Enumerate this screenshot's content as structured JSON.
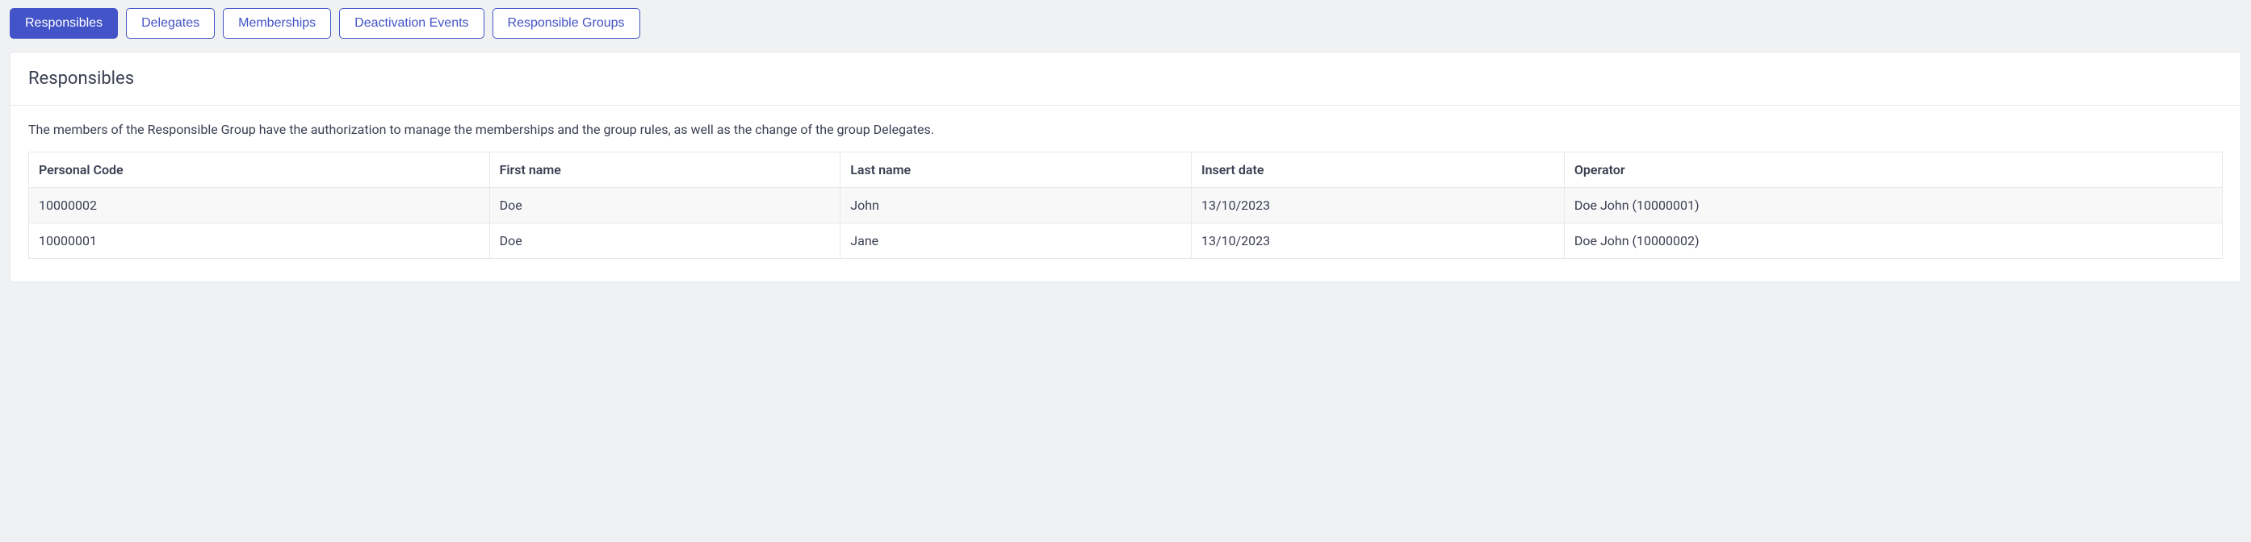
{
  "tabs": [
    {
      "label": "Responsibles",
      "active": true
    },
    {
      "label": "Delegates",
      "active": false
    },
    {
      "label": "Memberships",
      "active": false
    },
    {
      "label": "Deactivation Events",
      "active": false
    },
    {
      "label": "Responsible Groups",
      "active": false
    }
  ],
  "panel": {
    "title": "Responsibles",
    "description": "The members of the Responsible Group have the authorization to manage the memberships and the group rules, as well as the change of the group Delegates."
  },
  "table": {
    "columns": [
      "Personal Code",
      "First name",
      "Last name",
      "Insert date",
      "Operator"
    ],
    "rows": [
      {
        "personal_code": "10000002",
        "first_name": "Doe",
        "last_name": "John",
        "insert_date": "13/10/2023",
        "operator": "Doe John (10000001)"
      },
      {
        "personal_code": "10000001",
        "first_name": "Doe",
        "last_name": "Jane",
        "insert_date": "13/10/2023",
        "operator": "Doe John (10000002)"
      }
    ]
  }
}
